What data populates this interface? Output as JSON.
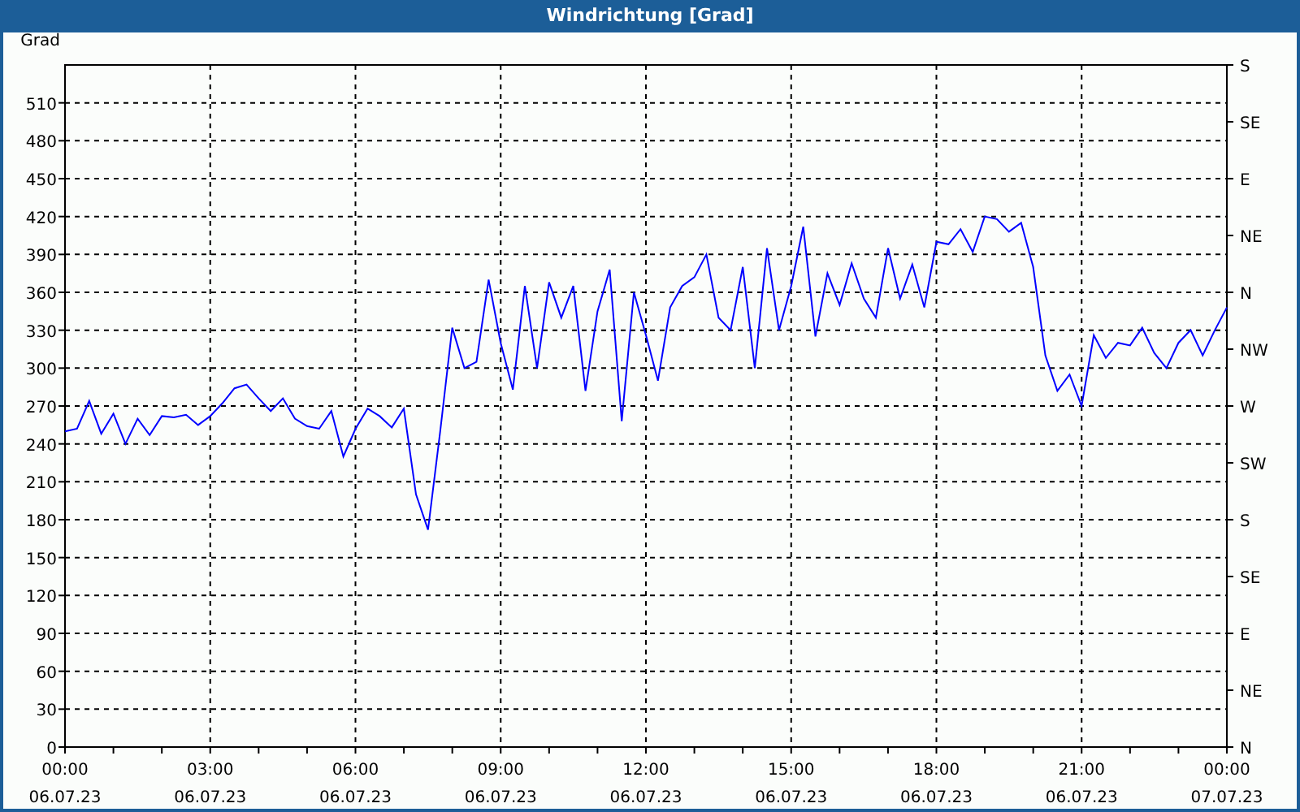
{
  "window": {
    "title": "Windrichtung [Grad]"
  },
  "chart_data": {
    "type": "line",
    "grid": true,
    "ylabel": "Grad",
    "ylim": [
      0,
      540
    ],
    "yticks": [
      0,
      30,
      60,
      90,
      120,
      150,
      180,
      210,
      240,
      270,
      300,
      330,
      360,
      390,
      420,
      450,
      480,
      510
    ],
    "categories": [
      "00:00\n06.07.23",
      null,
      null,
      null,
      null,
      null,
      null,
      null,
      null,
      null,
      null,
      null,
      "03:00\n06.07.23",
      null,
      null,
      null,
      null,
      null,
      null,
      null,
      null,
      null,
      null,
      null,
      "06:00\n06.07.23",
      null,
      null,
      null,
      null,
      null,
      null,
      null,
      null,
      null,
      null,
      null,
      "09:00\n06.07.23",
      null,
      null,
      null,
      null,
      null,
      null,
      null,
      null,
      null,
      null,
      null,
      "12:00\n06.07.23",
      null,
      null,
      null,
      null,
      null,
      null,
      null,
      null,
      null,
      null,
      null,
      "15:00\n06.07.23",
      null,
      null,
      null,
      null,
      null,
      null,
      null,
      null,
      null,
      null,
      null,
      "18:00\n06.07.23",
      null,
      null,
      null,
      null,
      null,
      null,
      null,
      null,
      null,
      null,
      null,
      "21:00\n06.07.23",
      null,
      null,
      null,
      null,
      null,
      null,
      null,
      null,
      null,
      null,
      null,
      "00:00\n07.07.23"
    ],
    "series": [
      {
        "color": "#0000ff",
        "values": [
          250,
          252,
          274,
          248,
          264,
          240,
          260,
          247,
          262,
          261,
          263,
          255,
          262,
          272,
          284,
          287,
          276,
          266,
          276,
          260,
          254,
          252,
          266,
          230,
          252,
          268,
          262,
          253,
          268,
          200,
          172,
          250,
          332,
          300,
          305,
          370,
          320,
          283,
          365,
          300,
          368,
          340,
          365,
          282,
          345,
          378,
          258,
          360,
          326,
          290,
          348,
          365,
          372,
          390,
          340,
          330,
          380,
          300,
          395,
          330,
          365,
          412,
          325,
          375,
          350,
          383,
          355,
          340,
          395,
          355,
          382,
          348,
          400,
          398,
          410,
          392,
          420,
          418,
          408,
          415,
          380,
          310,
          282,
          295,
          270,
          326,
          308,
          320,
          318,
          332,
          312,
          300,
          320,
          330,
          310,
          330,
          348
        ]
      }
    ]
  },
  "right_axis": {
    "labels": [
      "S",
      "SE",
      "E",
      "NE",
      "N",
      "NW",
      "W",
      "SW",
      "S",
      "SE",
      "E",
      "NE",
      "N"
    ]
  }
}
